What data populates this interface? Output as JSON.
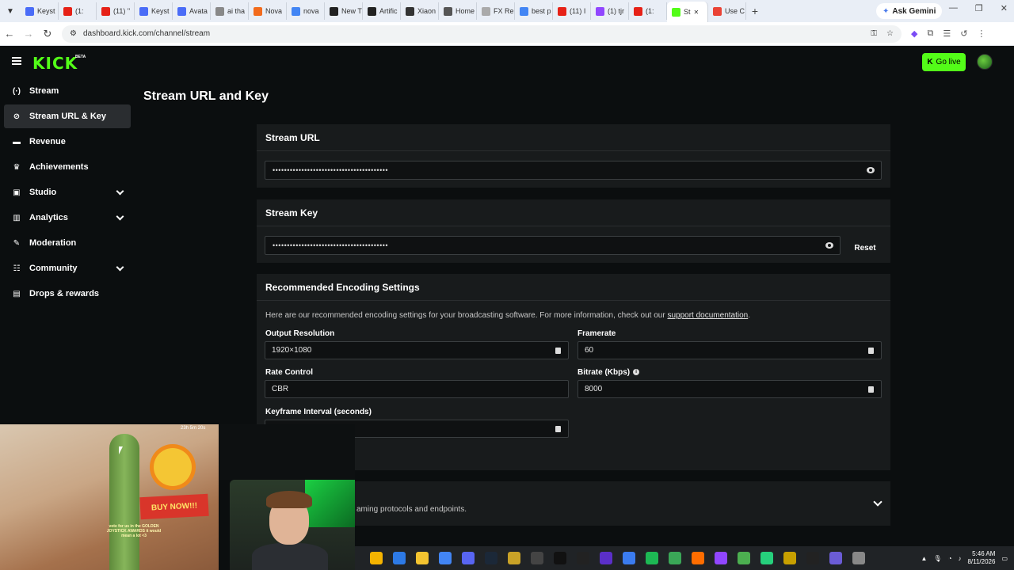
{
  "browser": {
    "tabs": [
      {
        "label": "Keyst",
        "color": "#4a6cf7"
      },
      {
        "label": "(1:",
        "color": "#e62117"
      },
      {
        "label": "(11) \"",
        "color": "#e62117"
      },
      {
        "label": "Keyst",
        "color": "#4a6cf7"
      },
      {
        "label": "Avata",
        "color": "#4a6cf7"
      },
      {
        "label": "ai tha",
        "color": "#888888"
      },
      {
        "label": "Nova",
        "color": "#f26b1d"
      },
      {
        "label": "nova",
        "color": "#4285f4"
      },
      {
        "label": "New T",
        "color": "#222222"
      },
      {
        "label": "Artific",
        "color": "#222222"
      },
      {
        "label": "Xiaon",
        "color": "#333333"
      },
      {
        "label": "Home",
        "color": "#555555"
      },
      {
        "label": "FX Re",
        "color": "#aaaaaa"
      },
      {
        "label": "best p",
        "color": "#4285f4"
      },
      {
        "label": "(11) I",
        "color": "#e62117"
      },
      {
        "label": "(1) tjr",
        "color": "#9146ff"
      },
      {
        "label": "(1:",
        "color": "#e62117"
      },
      {
        "label": "St",
        "color": "#53fc18",
        "active": true
      },
      {
        "label": "Use C",
        "color": "#ea4335"
      }
    ],
    "new_tab": "+",
    "ask_gemini": "Ask Gemini",
    "url": "dashboard.kick.com/channel/stream"
  },
  "header": {
    "logo": "KICK",
    "logo_badge": "BETA",
    "go_live": "Go live"
  },
  "sidebar": {
    "items": [
      {
        "label": "Stream",
        "icon": "(·)",
        "expandable": false
      },
      {
        "label": "Stream URL & Key",
        "icon": "⊘",
        "expandable": false,
        "active": true
      },
      {
        "label": "Revenue",
        "icon": "▬",
        "expandable": false
      },
      {
        "label": "Achievements",
        "icon": "♛",
        "expandable": false
      },
      {
        "label": "Studio",
        "icon": "▣",
        "expandable": true
      },
      {
        "label": "Analytics",
        "icon": "▥",
        "expandable": true
      },
      {
        "label": "Moderation",
        "icon": "✎",
        "expandable": false
      },
      {
        "label": "Community",
        "icon": "☷",
        "expandable": true
      },
      {
        "label": "Drops & rewards",
        "icon": "▤",
        "expandable": false
      }
    ]
  },
  "main": {
    "title": "Stream URL and Key",
    "stream_url": {
      "heading": "Stream URL",
      "value": "••••••••••••••••••••••••••••••••••••••••"
    },
    "stream_key": {
      "heading": "Stream Key",
      "value": "••••••••••••••••••••••••••••••••••••••••",
      "reset": "Reset"
    },
    "encoding": {
      "heading": "Recommended Encoding Settings",
      "description": "Here are our recommended encoding settings for your broadcasting software. For more information, check out our ",
      "link": "support documentation",
      "period": ".",
      "output_resolution_label": "Output Resolution",
      "output_resolution_value": "1920×1080",
      "framerate_label": "Framerate",
      "framerate_value": "60",
      "rate_control_label": "Rate Control",
      "rate_control_value": "CBR",
      "bitrate_label": "Bitrate (Kbps)",
      "bitrate_value": "8000",
      "keyframe_label": "Keyframe Interval (seconds)",
      "keyframe_value": ""
    },
    "advanced_partial_text": "aming protocols and endpoints."
  },
  "overlay": {
    "timer": "23h 5m 20s",
    "buy_sign": "BUY NOW!!!",
    "vote_text": "vote for us in the GOLDEN JOYSTICK AWARDS it would mean a lot <3"
  },
  "taskbar": {
    "icons": [
      "#f5b400",
      "#2d7ae6",
      "#f4c430",
      "#4285f4",
      "#5865f2",
      "#1b2838",
      "#c9a227",
      "#444444",
      "#111111",
      "#222222",
      "#5b2fc9",
      "#3b7cf0",
      "#1db954",
      "#3aa757",
      "#ff6d00",
      "#9146ff",
      "#4caf50",
      "#26d07c",
      "#c8a000",
      "#222222",
      "#6b5cd6",
      "#888888"
    ],
    "time": "5:46 AM",
    "date": "8/11/2026"
  }
}
